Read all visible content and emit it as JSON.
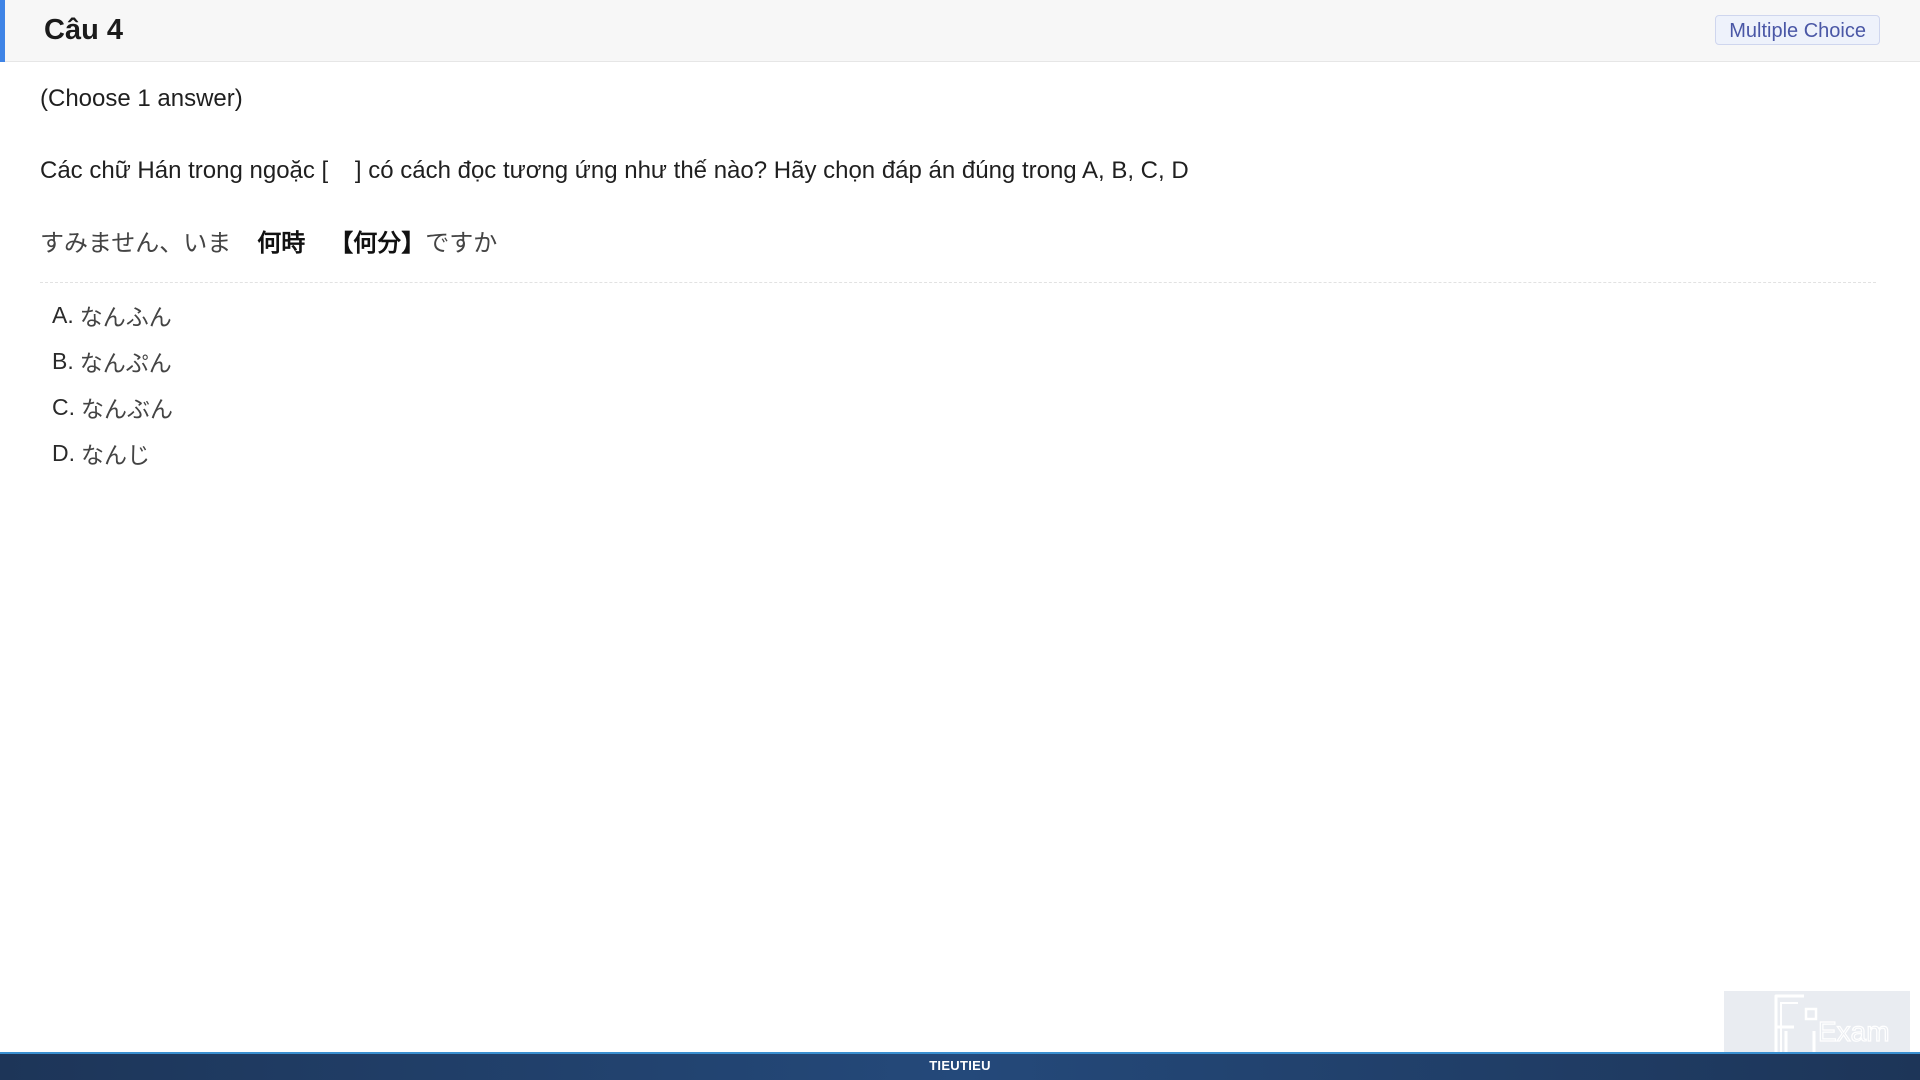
{
  "header": {
    "title": "Câu 4",
    "type_badge": "Multiple Choice",
    "accent_color": "#3f84e6"
  },
  "question": {
    "instruction": "(Choose 1 answer)",
    "prompt": "Các chữ Hán trong ngoặc [    ] có cách đọc tương ứng như thế nào? Hãy chọn đáp án đúng trong A, B, C, D",
    "sentence": {
      "part1": "すみません、いま",
      "kanji": "何時",
      "bracketed": "【何分】",
      "part2": "ですか"
    }
  },
  "options": [
    {
      "letter": "A.",
      "text": "なんふん"
    },
    {
      "letter": "B.",
      "text": "なんぷん"
    },
    {
      "letter": "C.",
      "text": "なんぶん"
    },
    {
      "letter": "D.",
      "text": "なんじ"
    }
  ],
  "footer": {
    "text": "TIEUTIEU"
  },
  "logo": {
    "icon": "fu-exam-logo",
    "text": "Exam"
  }
}
